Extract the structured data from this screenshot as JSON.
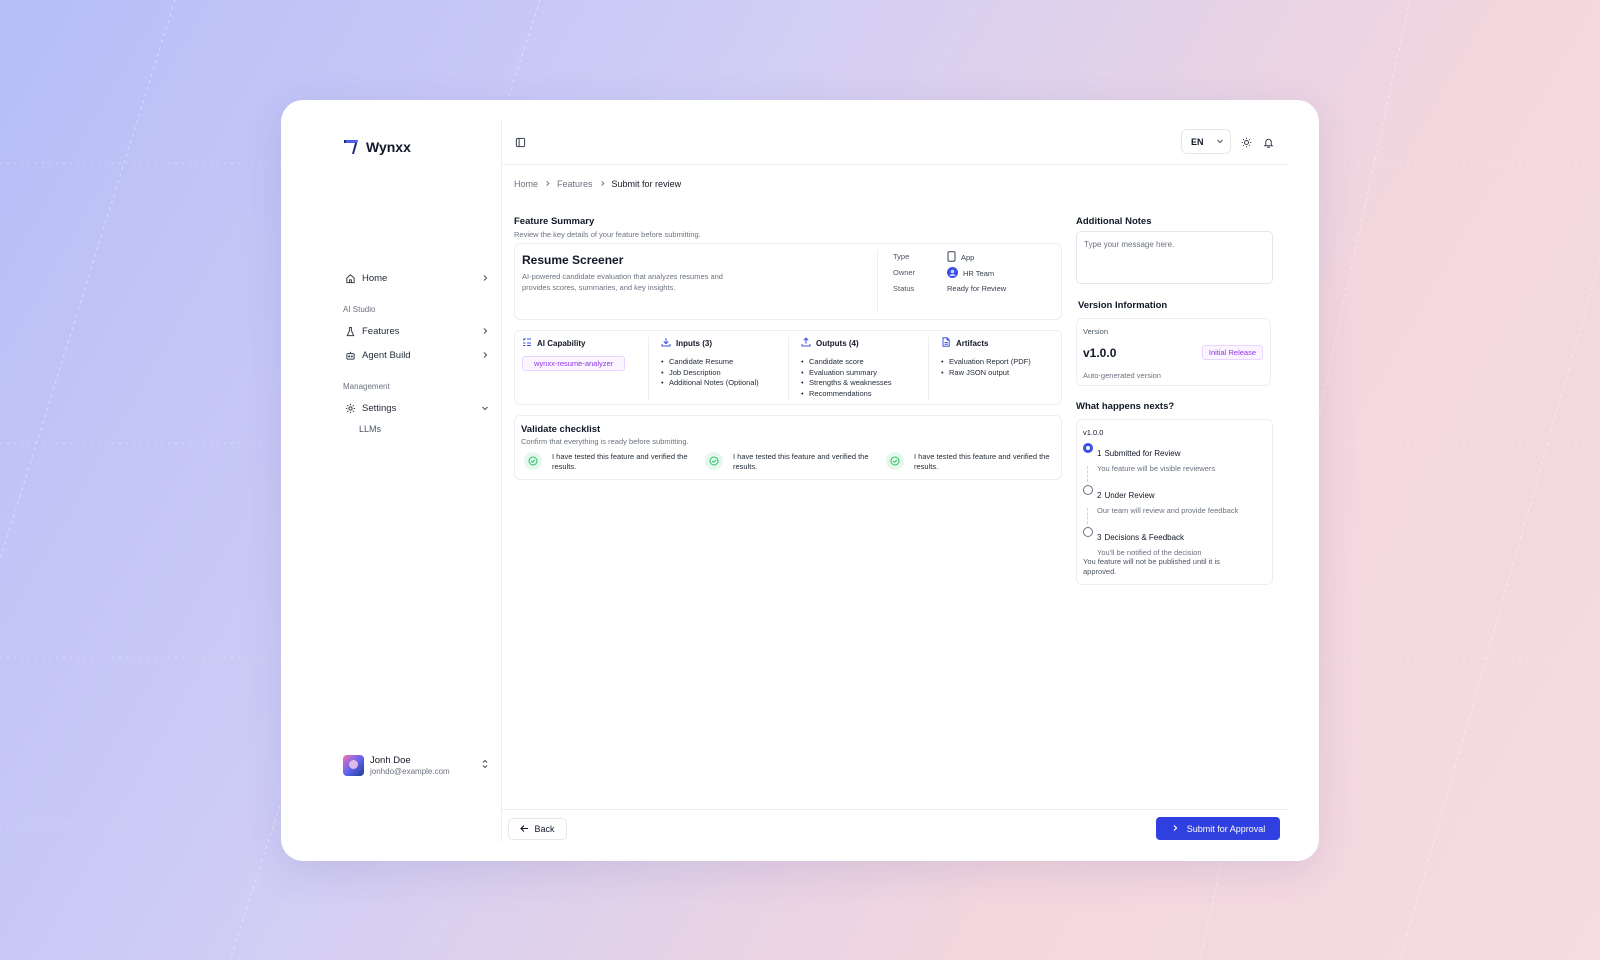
{
  "app": {
    "name": "Wynxx"
  },
  "sidebar": {
    "home": "Home",
    "section_ai": "AI Studio",
    "features": "Features",
    "agent_build": "Agent Build",
    "section_management": "Management",
    "settings": "Settings",
    "llms": "LLMs",
    "user": {
      "name": "Jonh Doe",
      "email": "jonhdo@example.com"
    }
  },
  "topbar": {
    "language": "EN"
  },
  "breadcrumb": [
    "Home",
    "Features",
    "Submit for review"
  ],
  "feature_summary": {
    "title": "Feature Summary",
    "subtitle": "Review the key details of your feature before submitting.",
    "name": "Resume Screener",
    "description": "AI-powered candidate evaluation that analyzes resumes and provides scores, summaries, and key insights.",
    "type_label": "Type",
    "type_value": "App",
    "owner_label": "Owner",
    "owner_value": "HR Team",
    "status_label": "Status",
    "status_value": "Ready for Review"
  },
  "capability": {
    "ai": {
      "title": "AI Capability",
      "chip": "wynxx-resume-analyzer"
    },
    "inputs": {
      "title": "Inputs (3)",
      "items": [
        "Candidate Resume",
        "Job Description",
        "Additional Notes (Optional)"
      ]
    },
    "outputs": {
      "title": "Outputs (4)",
      "items": [
        "Candidate score",
        "Evaluation summary",
        "Strengths & weaknesses",
        "Recommendations"
      ]
    },
    "artifacts": {
      "title": "Artifacts",
      "items": [
        "Evaluation Report (PDF)",
        "Raw JSON output"
      ]
    }
  },
  "checklist": {
    "title": "Validate checklist",
    "subtitle": "Confirm that everything is ready before submitting.",
    "items": [
      "I have tested this feature and verified the results.",
      "I have tested this feature and verified the results.",
      "I have tested this feature and verified the results."
    ]
  },
  "notes": {
    "title": "Additional Notes",
    "placeholder": "Type your message here."
  },
  "version": {
    "title": "Version Information",
    "label": "Version",
    "value": "v1.0.0",
    "badge": "Initial Release",
    "note": "Auto-generated version"
  },
  "next": {
    "title": "What happens nexts?",
    "version": "v1.0.0",
    "steps": [
      {
        "num": "1",
        "title": "Submitted for Review",
        "desc": "You feature will be visible reviewers"
      },
      {
        "num": "2",
        "title": "Under Review",
        "desc": "Our team will review and provide  feedback"
      },
      {
        "num": "3",
        "title": "Decisions & Feedback",
        "desc": "You'll  be notified of the decision"
      }
    ],
    "footnote": "You feature will not be published until it is approved."
  },
  "footer": {
    "back": "Back",
    "submit": "Submit for Approval"
  },
  "colors": {
    "accent": "#2f3fe0",
    "purple": "#9333ea",
    "success": "#22c55e"
  },
  "icons": {
    "home": "home-icon",
    "features": "flask-icon",
    "agent": "bot-icon",
    "settings": "gear-icon",
    "panel": "sidebar-panel-icon",
    "theme": "sun-icon",
    "notifications": "bell-icon"
  }
}
